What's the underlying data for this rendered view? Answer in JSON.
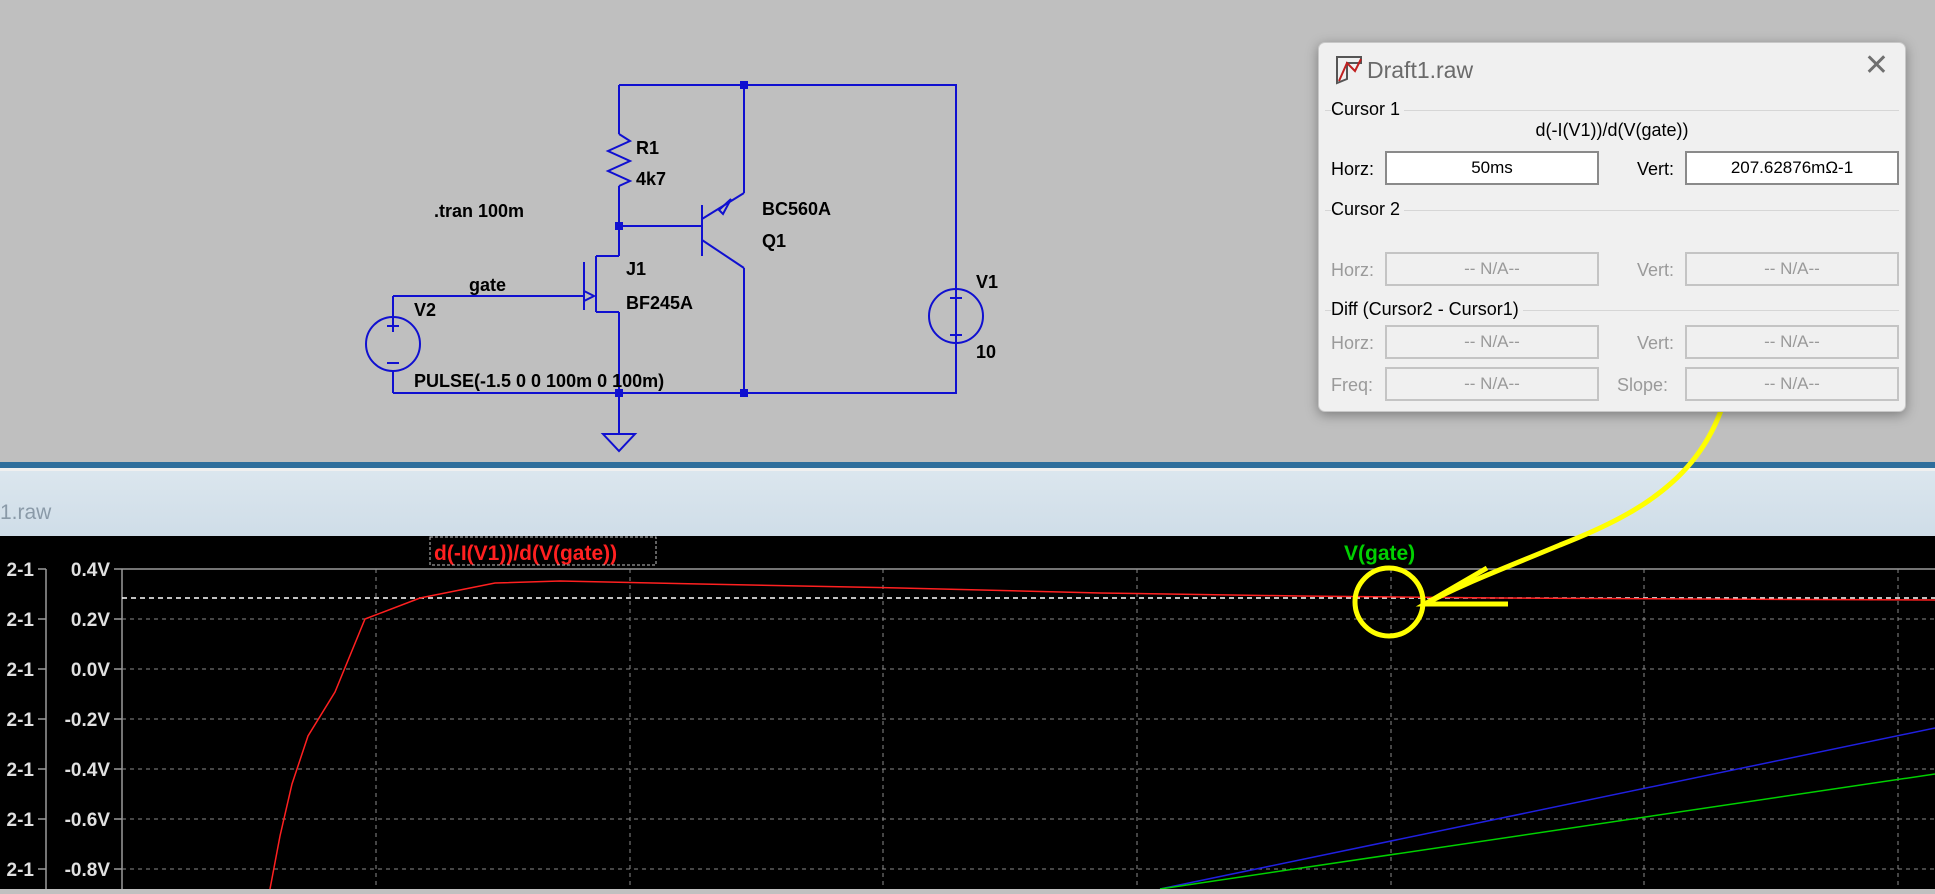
{
  "schematic": {
    "directive": ".tran 100m",
    "net_label": "gate",
    "v2_name": "V2",
    "v2_value": "PULSE(-1.5 0 0 100m 0 100m)",
    "r1_name": "R1",
    "r1_value": "4k7",
    "j1_name": "J1",
    "j1_model": "BF245A",
    "q1_model": "BC560A",
    "q1_name": "Q1",
    "v1_name": "V1",
    "v1_value": "10"
  },
  "waveform_window": {
    "title": "1.raw"
  },
  "plot": {
    "trace1_label": "d(-I(V1))/d(V(gate))",
    "trace2_label": "V(gate)",
    "y_ticks": [
      "0.4V",
      "0.2V",
      "0.0V",
      "-0.2V",
      "-0.4V",
      "-0.6V",
      "-0.8V"
    ],
    "left_ticks": [
      "2-1",
      "2-1",
      "2-1",
      "2-1",
      "2-1",
      "2-1",
      "2-1"
    ],
    "colors": {
      "trace1": "#ff2020",
      "trace2": "#00d000",
      "trace3": "#2020e0",
      "grid": "#9a9a9a"
    }
  },
  "dialog": {
    "title": "Draft1.raw",
    "cursor1_label": "Cursor 1",
    "expression": "d(-I(V1))/d(V(gate))",
    "horz_label": "Horz:",
    "vert_label": "Vert:",
    "cursor1_horz": "50ms",
    "cursor1_vert": "207.62876mΩ-1",
    "cursor2_label": "Cursor 2",
    "na": "-- N/A--",
    "diff_label": "Diff (Cursor2 - Cursor1)",
    "freq_label": "Freq:",
    "slope_label": "Slope:"
  },
  "annotation_color": "#ffff00"
}
